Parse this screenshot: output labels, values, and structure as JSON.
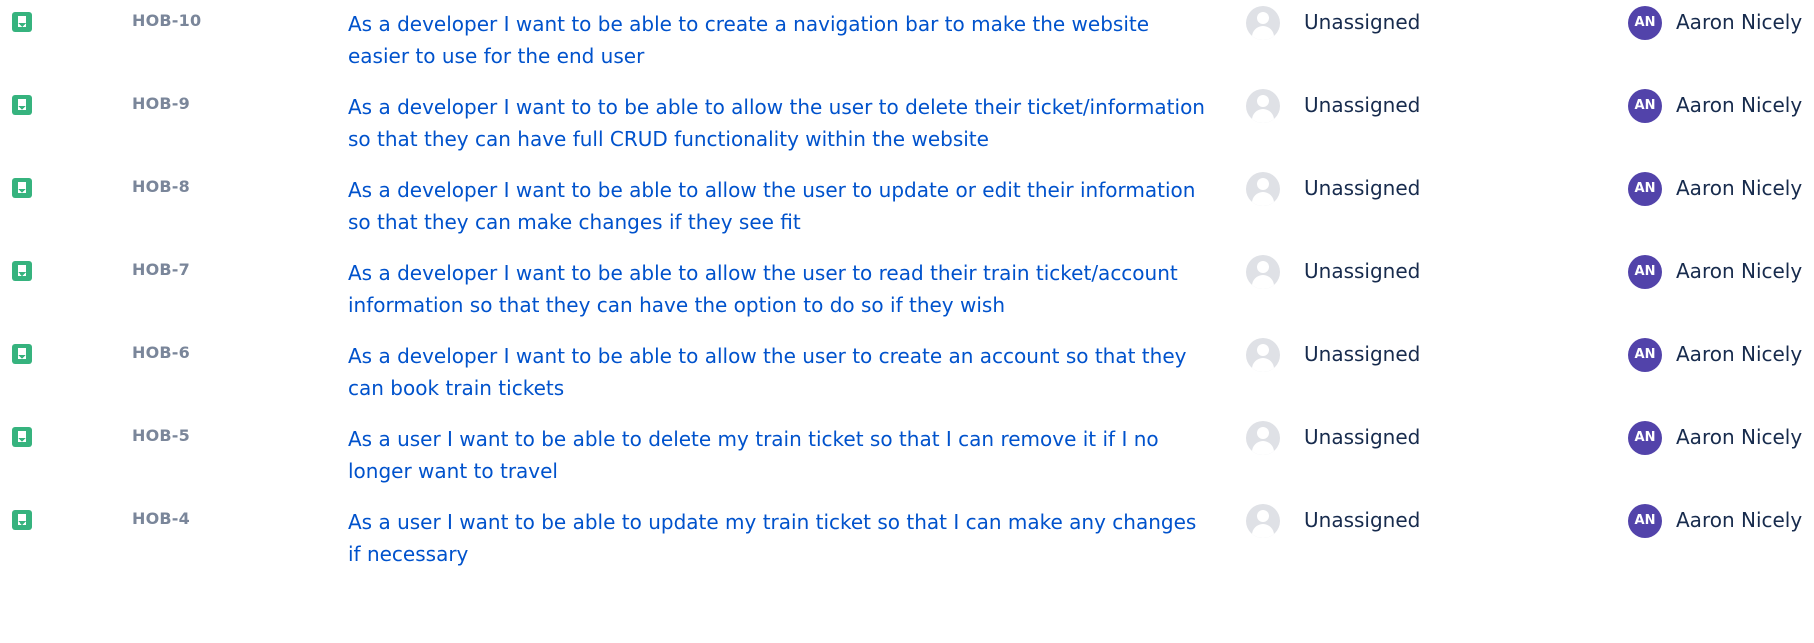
{
  "issues": [
    {
      "key": "HOB-10",
      "type_icon": "story-icon",
      "summary": "As a developer I want to be able to create a navigation bar to make the website easier to use for the end user",
      "assignee": "Unassigned",
      "reporter": {
        "name": "Aaron Nicely",
        "initials": "AN"
      }
    },
    {
      "key": "HOB-9",
      "type_icon": "story-icon",
      "summary": "As a developer I want to to be able to allow the user to delete their ticket/information so that they can have full CRUD functionality within the website",
      "assignee": "Unassigned",
      "reporter": {
        "name": "Aaron Nicely",
        "initials": "AN"
      }
    },
    {
      "key": "HOB-8",
      "type_icon": "story-icon",
      "summary": "As a developer I want to be able to allow the user to update or edit their information so that they can make changes if they see fit",
      "assignee": "Unassigned",
      "reporter": {
        "name": "Aaron Nicely",
        "initials": "AN"
      }
    },
    {
      "key": "HOB-7",
      "type_icon": "story-icon",
      "summary": "As a developer I want to be able to allow the user to read their train ticket/account information so that they can have the option to do so if they wish",
      "assignee": "Unassigned",
      "reporter": {
        "name": "Aaron Nicely",
        "initials": "AN"
      }
    },
    {
      "key": "HOB-6",
      "type_icon": "story-icon",
      "summary": "As a developer I want to be able to allow the user to create an account so that they can book train tickets",
      "assignee": "Unassigned",
      "reporter": {
        "name": "Aaron Nicely",
        "initials": "AN"
      }
    },
    {
      "key": "HOB-5",
      "type_icon": "story-icon",
      "summary": "As a user I want to be able to delete my train ticket so that I can remove it if I no longer want to travel",
      "assignee": "Unassigned",
      "reporter": {
        "name": "Aaron Nicely",
        "initials": "AN"
      }
    },
    {
      "key": "HOB-4",
      "type_icon": "story-icon",
      "summary": "As a user I want to be able to update my train ticket so that I can make any changes if necessary",
      "assignee": "Unassigned",
      "reporter": {
        "name": "Aaron Nicely",
        "initials": "AN"
      }
    }
  ],
  "colors": {
    "story_icon": "#36b37e",
    "link": "#0052cc",
    "key_text": "#7a869a",
    "reporter_avatar": "#5243aa",
    "unassigned_avatar": "#dfe1e6"
  }
}
